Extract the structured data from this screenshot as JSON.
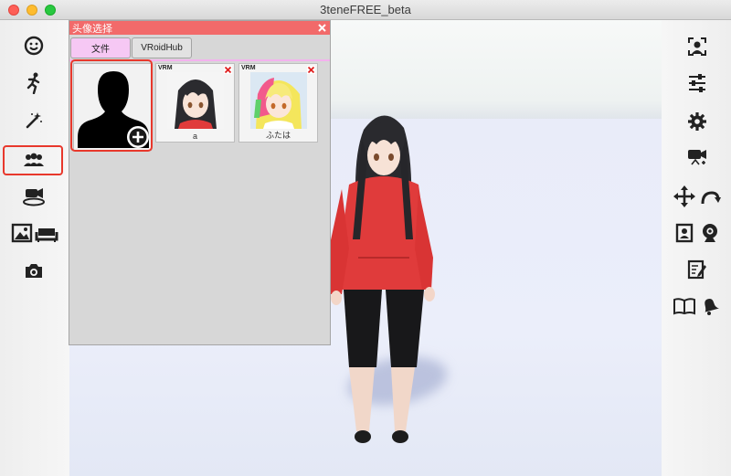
{
  "window": {
    "title": "3teneFREE_beta"
  },
  "panel": {
    "title": "头像选择",
    "tabs": [
      {
        "label": "文件",
        "active": true
      },
      {
        "label": "VRoidHub",
        "active": false
      }
    ],
    "cards": [
      {
        "type": "add",
        "badge": ""
      },
      {
        "type": "avatar",
        "badge": "VRM",
        "name": "a"
      },
      {
        "type": "avatar",
        "badge": "VRM",
        "name": "ふたは"
      }
    ]
  },
  "left_toolbar": {
    "items": [
      "face-icon",
      "motion-icon",
      "effects-icon",
      "avatar-select-icon",
      "camera-stage-icon",
      "background-icon",
      "screenshot-icon"
    ],
    "selected": "avatar-select-icon"
  },
  "right_toolbar": {
    "items": [
      "face-frame-icon",
      "sliders-icon",
      "gear-icon",
      "video-camera-icon",
      "move-icon",
      "rotate-icon",
      "portrait-icon",
      "webcam-icon",
      "edit-icon",
      "book-icon",
      "bell-icon"
    ]
  },
  "colors": {
    "panel_title": "#f26a6a",
    "tab_active": "#f6c8f4",
    "highlight_red": "#e8382c",
    "hoodie_red": "#e03b3b"
  }
}
